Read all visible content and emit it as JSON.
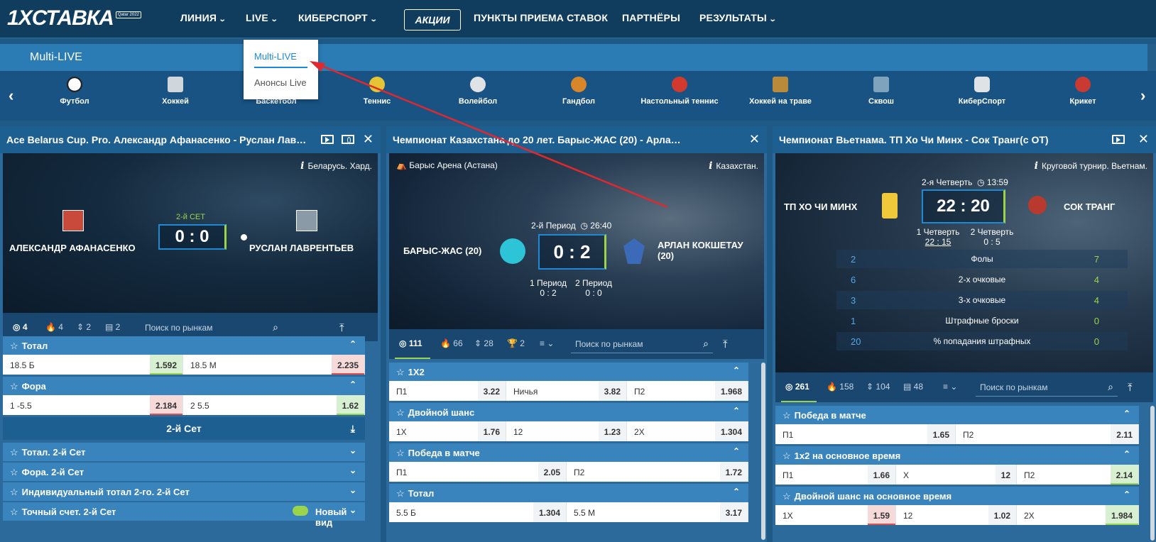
{
  "nav": {
    "logo": "1XСТАВКА",
    "logo_badge": "Qatar 2022",
    "items": [
      "ЛИНИЯ",
      "LIVE",
      "КИБЕРСПОРТ",
      "АКЦИИ",
      "ПУНКТЫ ПРИЕМА СТАВОК",
      "ПАРТНЁРЫ",
      "РЕЗУЛЬТАТЫ"
    ]
  },
  "multilive": {
    "title": "Multi-LIVE"
  },
  "dropdown": {
    "items": [
      "Multi-LIVE",
      "Анонсы Live"
    ]
  },
  "sports": [
    "Футбол",
    "Хоккей",
    "Баскетбол",
    "Теннис",
    "Волейбол",
    "Гандбол",
    "Настольный теннис",
    "Хоккей на траве",
    "Сквош",
    "КиберСпорт",
    "Крикет"
  ],
  "panel1": {
    "title": "Ace Belarus Cup. Pro. Александр Афанасенко - Руслан Лав…",
    "info": "Беларусь. Хард.",
    "period": "2-й СЕТ",
    "score": "0 : 0",
    "team1": "АЛЕКСАНДР АФАНАСЕНКО",
    "team2": "РУСЛАН ЛАВРЕНТЬЕВ",
    "counts": [
      "4",
      "4",
      "2",
      "2"
    ],
    "search": "Поиск по рынкам",
    "markets": [
      {
        "name": "Тотал",
        "cells": [
          [
            "18.5 Б",
            "1.592",
            "up"
          ],
          [
            "18.5 М",
            "2.235",
            "down"
          ]
        ]
      },
      {
        "name": "Фора",
        "cells": [
          [
            "1 -5.5",
            "2.184",
            "down"
          ],
          [
            "2 5.5",
            "1.62",
            "up"
          ]
        ]
      }
    ],
    "set_header": "2-й Сет",
    "collapsed": [
      "Тотал. 2-й Сет",
      "Фора. 2-й Сет",
      "Индивидуальный тотал 2-го. 2-й Сет",
      "Точный счет. 2-й Сет"
    ],
    "new_view": "Новый вид"
  },
  "panel2": {
    "title": "Чемпионат Казахстана до 20 лет. Барыс-ЖАС (20) - Арла…",
    "venue": "Барыс Арена (Астана)",
    "info": "Казахстан.",
    "period": "2-й Период",
    "time": "26:40",
    "score": "0 : 2",
    "team1": "БАРЫС-ЖАС (20)",
    "team2": "АРЛАН КОКШЕТАУ (20)",
    "p1_label": "1 Период",
    "p1_score": "0 : 2",
    "p2_label": "2 Период",
    "p2_score": "0 : 0",
    "counts": [
      "111",
      "66",
      "28",
      "2"
    ],
    "search": "Поиск по рынкам",
    "markets": [
      {
        "name": "1X2",
        "cells": [
          [
            "П1",
            "3.22",
            ""
          ],
          [
            "Ничья",
            "3.82",
            ""
          ],
          [
            "П2",
            "1.968",
            ""
          ]
        ]
      },
      {
        "name": "Двойной шанс",
        "cells": [
          [
            "1X",
            "1.76",
            ""
          ],
          [
            "12",
            "1.23",
            ""
          ],
          [
            "2X",
            "1.304",
            ""
          ]
        ]
      },
      {
        "name": "Победа в матче",
        "cells": [
          [
            "П1",
            "2.05",
            ""
          ],
          [
            "П2",
            "1.72",
            ""
          ]
        ]
      },
      {
        "name": "Тотал",
        "cells": [
          [
            "5.5 Б",
            "1.304",
            ""
          ],
          [
            "5.5 М",
            "3.17",
            ""
          ]
        ]
      }
    ]
  },
  "panel3": {
    "title": "Чемпионат Вьетнама. ТП Хо Чи Минх - Сок Транг(с ОТ)",
    "info": "Круговой турнир. Вьетнам.",
    "period": "2-я Четверть",
    "time": "13:59",
    "score": "22 : 20",
    "team1": "ТП ХО ЧИ МИНХ",
    "team2": "СОК ТРАНГ",
    "q1_label": "1 Четверть",
    "q1_score": "22 : 15",
    "q2_label": "2 Четверть",
    "q2_score": "0 : 5",
    "stats": [
      {
        "a": "2",
        "name": "Фолы",
        "b": "7"
      },
      {
        "a": "6",
        "name": "2-х очковые",
        "b": "4"
      },
      {
        "a": "3",
        "name": "3-х очковые",
        "b": "4"
      },
      {
        "a": "1",
        "name": "Штрафные броски",
        "b": "0"
      },
      {
        "a": "20",
        "name": "% попадания штрафных",
        "b": "0"
      }
    ],
    "counts": [
      "261",
      "158",
      "104",
      "48"
    ],
    "search": "Поиск по рынкам",
    "markets": [
      {
        "name": "Победа в матче",
        "cells": [
          [
            "П1",
            "1.65",
            ""
          ],
          [
            "П2",
            "2.11",
            ""
          ]
        ]
      },
      {
        "name": "1x2 на основное время",
        "cells": [
          [
            "П1",
            "1.66",
            ""
          ],
          [
            "X",
            "12",
            ""
          ],
          [
            "П2",
            "2.14",
            "up"
          ]
        ]
      },
      {
        "name": "Двойной шанс на основное время",
        "cells": [
          [
            "1X",
            "1.59",
            "down"
          ],
          [
            "12",
            "1.02",
            ""
          ],
          [
            "2X",
            "1.984",
            "up"
          ]
        ]
      }
    ]
  },
  "colors": {
    "accent": "#1a8ad8",
    "up": "#9bd34a",
    "down": "#e05050",
    "header": "#103c5e"
  }
}
